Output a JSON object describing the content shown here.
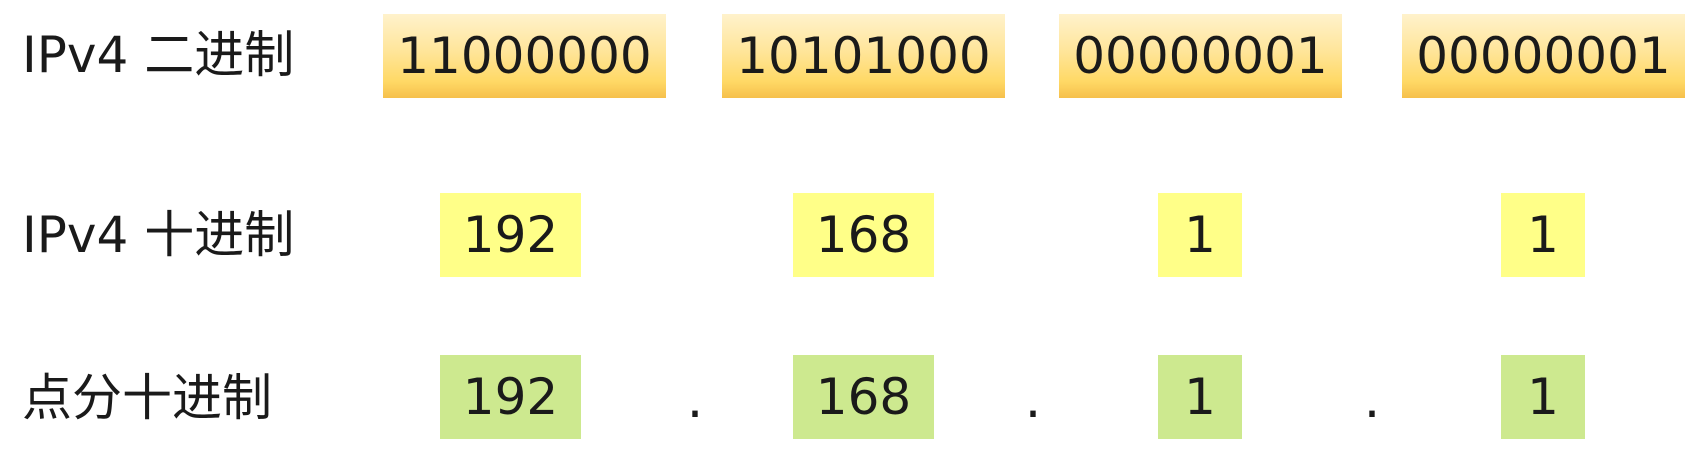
{
  "rows": {
    "binary": {
      "label": "IPv4 二进制",
      "octets": [
        "11000000",
        "10101000",
        "00000001",
        "00000001"
      ]
    },
    "decimal": {
      "label": "IPv4 十进制",
      "octets": [
        "192",
        "168",
        "1",
        "1"
      ]
    },
    "dotted": {
      "label": "点分十进制",
      "octets": [
        "192",
        "168",
        "1",
        "1"
      ],
      "separator": "."
    }
  },
  "colors": {
    "binary_fill": "#ffd966",
    "decimal_fill": "#ffff88",
    "dotted_fill": "#cde98f"
  }
}
